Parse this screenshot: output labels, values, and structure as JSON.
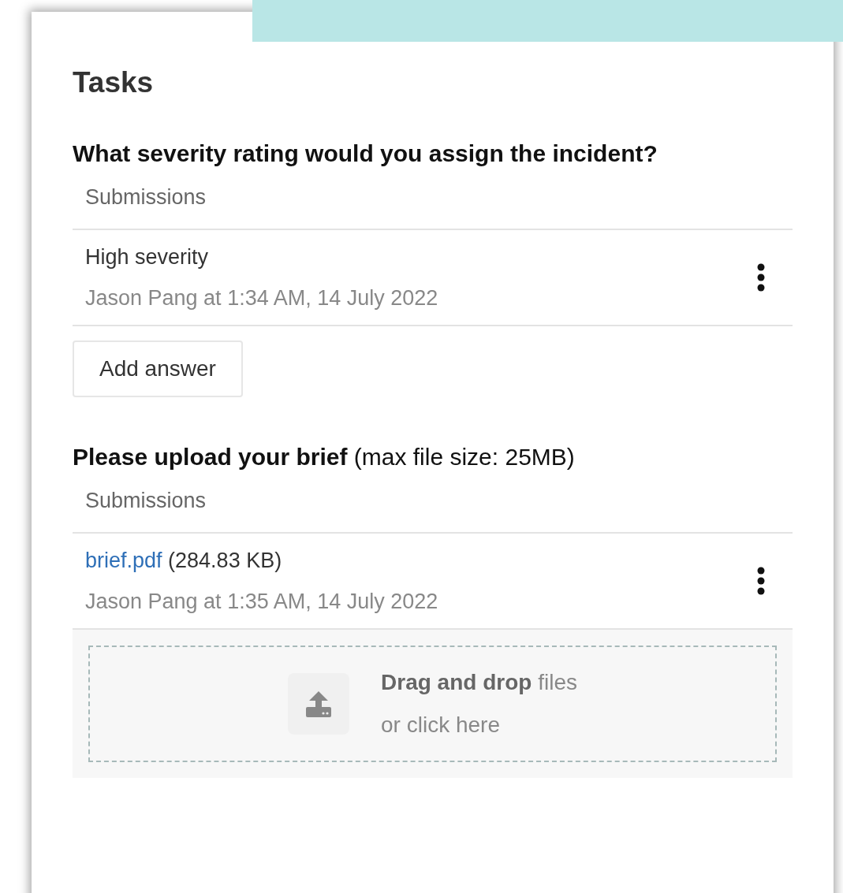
{
  "heading": "Tasks",
  "tasks": [
    {
      "kind": "text",
      "question": "What severity rating would you assign the incident?",
      "submissions_label": "Submissions",
      "submissions": [
        {
          "answer": "High severity",
          "meta": "Jason Pang at 1:34 AM, 14 July 2022"
        }
      ],
      "button": "Add answer"
    },
    {
      "kind": "upload",
      "question": "**Please upload your brief** (max file size: 25MB)",
      "submissions_label": "Submissions",
      "submissions": [
        {
          "file": "brief.pdf",
          "size": "(284.83 KB)",
          "meta": "Jason Pang at 1:35 AM, 14 July 2022"
        }
      ],
      "dropzone": {
        "title": "**Drag and drop** files",
        "subtitle": "or click here"
      }
    }
  ]
}
